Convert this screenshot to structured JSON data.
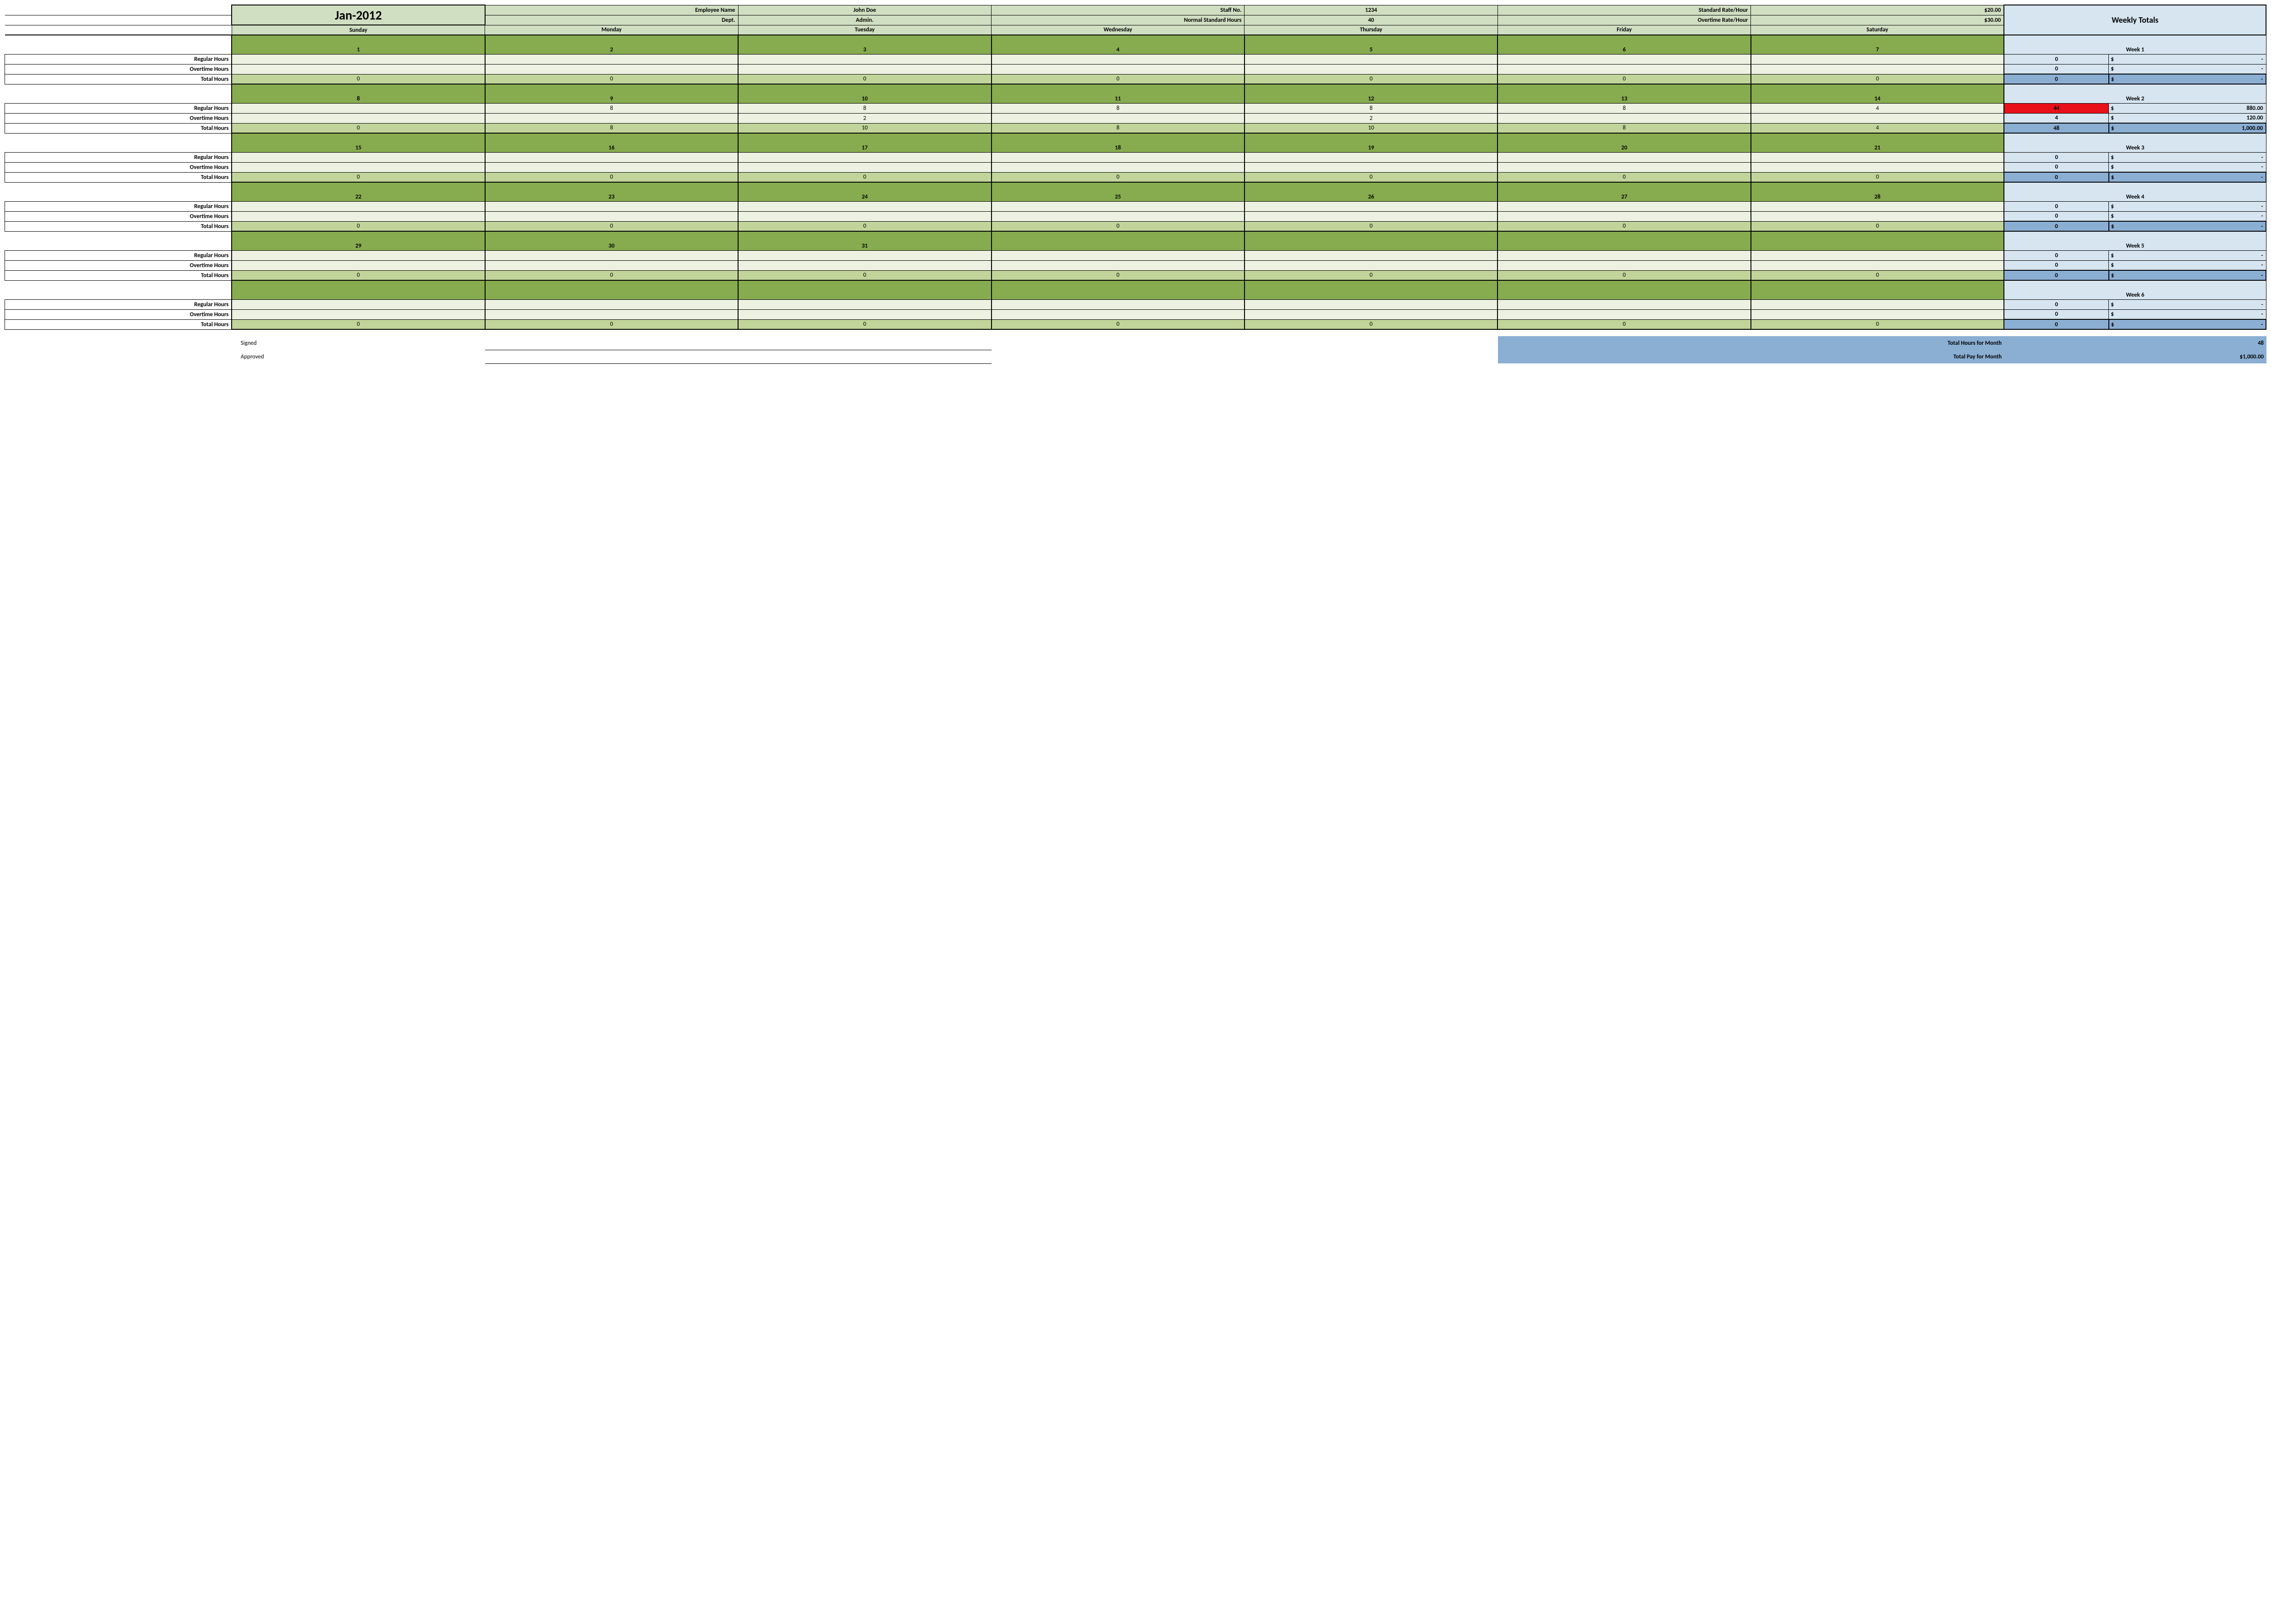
{
  "month": "Jan-2012",
  "info": {
    "emp_name_lbl": "Employee Name",
    "emp_name_val": "John Doe",
    "staff_no_lbl": "Staff No.",
    "staff_no_val": "1234",
    "std_rate_lbl": "Standard Rate/Hour",
    "std_rate_val": "$20.00",
    "dept_lbl": "Dept.",
    "dept_val": "Admin.",
    "norm_hours_lbl": "Normal Standard Hours",
    "norm_hours_val": "40",
    "ot_rate_lbl": "Overtime Rate/Hour",
    "ot_rate_val": "$30.00"
  },
  "days": [
    "Sunday",
    "Monday",
    "Tuesday",
    "Wednesday",
    "Thursday",
    "Friday",
    "Saturday"
  ],
  "weekly_totals_head": "Weekly Totals",
  "labels": {
    "regular": "Regular Hours",
    "overtime": "Overtime Hours",
    "total": "Total Hours",
    "signed": "Signed",
    "approved": "Approved",
    "total_hours_month": "Total Hours for Month",
    "total_pay_month": "Total Pay for Month"
  },
  "weeks": [
    {
      "name": "Week 1",
      "dates": [
        "1",
        "2",
        "3",
        "4",
        "5",
        "6",
        "7"
      ],
      "regular": [
        "",
        "",
        "",
        "",
        "",
        "",
        ""
      ],
      "overtime": [
        "",
        "",
        "",
        "",
        "",
        "",
        ""
      ],
      "total": [
        "0",
        "0",
        "0",
        "0",
        "0",
        "0",
        "0"
      ],
      "tot_reg_h": "0",
      "tot_reg_m": "-",
      "reg_alert": false,
      "tot_ot_h": "0",
      "tot_ot_m": "-",
      "tot_t_h": "0",
      "tot_t_m": "-"
    },
    {
      "name": "Week 2",
      "dates": [
        "8",
        "9",
        "10",
        "11",
        "12",
        "13",
        "14"
      ],
      "regular": [
        "",
        "8",
        "8",
        "8",
        "8",
        "8",
        "4"
      ],
      "overtime": [
        "",
        "",
        "2",
        "",
        "2",
        "",
        ""
      ],
      "total": [
        "0",
        "8",
        "10",
        "8",
        "10",
        "8",
        "4"
      ],
      "tot_reg_h": "44",
      "tot_reg_m": "880.00",
      "reg_alert": true,
      "tot_ot_h": "4",
      "tot_ot_m": "120.00",
      "tot_t_h": "48",
      "tot_t_m": "1,000.00"
    },
    {
      "name": "Week 3",
      "dates": [
        "15",
        "16",
        "17",
        "18",
        "19",
        "20",
        "21"
      ],
      "regular": [
        "",
        "",
        "",
        "",
        "",
        "",
        ""
      ],
      "overtime": [
        "",
        "",
        "",
        "",
        "",
        "",
        ""
      ],
      "total": [
        "0",
        "0",
        "0",
        "0",
        "0",
        "0",
        "0"
      ],
      "tot_reg_h": "0",
      "tot_reg_m": "-",
      "reg_alert": false,
      "tot_ot_h": "0",
      "tot_ot_m": "-",
      "tot_t_h": "0",
      "tot_t_m": "-"
    },
    {
      "name": "Week 4",
      "dates": [
        "22",
        "23",
        "24",
        "25",
        "26",
        "27",
        "28"
      ],
      "regular": [
        "",
        "",
        "",
        "",
        "",
        "",
        ""
      ],
      "overtime": [
        "",
        "",
        "",
        "",
        "",
        "",
        ""
      ],
      "total": [
        "0",
        "0",
        "0",
        "0",
        "0",
        "0",
        "0"
      ],
      "tot_reg_h": "0",
      "tot_reg_m": "-",
      "reg_alert": false,
      "tot_ot_h": "0",
      "tot_ot_m": "-",
      "tot_t_h": "0",
      "tot_t_m": "-"
    },
    {
      "name": "Week 5",
      "dates": [
        "29",
        "30",
        "31",
        "",
        "",
        "",
        ""
      ],
      "regular": [
        "",
        "",
        "",
        "",
        "",
        "",
        ""
      ],
      "overtime": [
        "",
        "",
        "",
        "",
        "",
        "",
        ""
      ],
      "total": [
        "0",
        "0",
        "0",
        "0",
        "0",
        "0",
        "0"
      ],
      "tot_reg_h": "0",
      "tot_reg_m": "-",
      "reg_alert": false,
      "tot_ot_h": "0",
      "tot_ot_m": "-",
      "tot_t_h": "0",
      "tot_t_m": "-"
    },
    {
      "name": "Week 6",
      "dates": [
        "",
        "",
        "",
        "",
        "",
        "",
        ""
      ],
      "regular": [
        "",
        "",
        "",
        "",
        "",
        "",
        ""
      ],
      "overtime": [
        "",
        "",
        "",
        "",
        "",
        "",
        ""
      ],
      "total": [
        "0",
        "0",
        "0",
        "0",
        "0",
        "0",
        "0"
      ],
      "tot_reg_h": "0",
      "tot_reg_m": "-",
      "reg_alert": false,
      "tot_ot_h": "0",
      "tot_ot_m": "-",
      "tot_t_h": "0",
      "tot_t_m": "-"
    }
  ],
  "month_totals": {
    "hours": "48",
    "pay": "$1,000.00"
  }
}
